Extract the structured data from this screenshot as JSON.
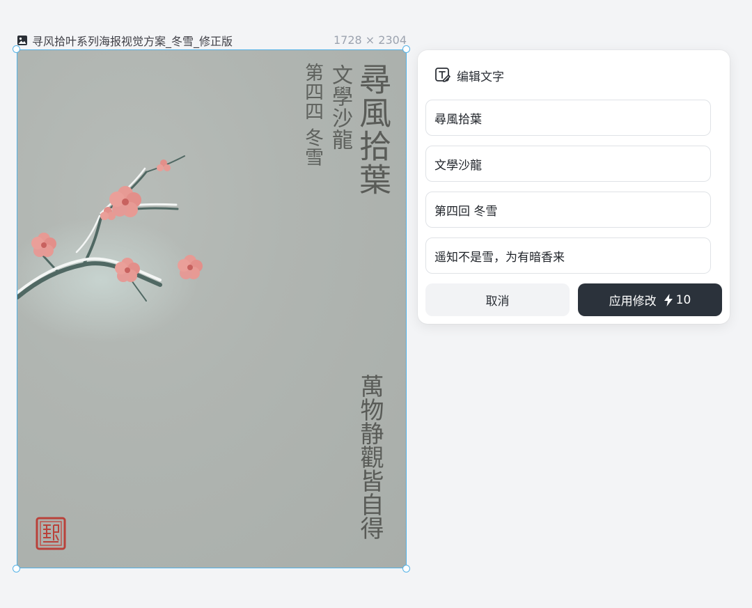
{
  "canvas": {
    "file_name": "寻风拾叶系列海报视觉方案_冬雪_修正版",
    "dimensions": "1728 × 2304",
    "icon": "image-icon"
  },
  "poster": {
    "title": "尋風拾葉",
    "subtitle": "文學沙龍",
    "chapter": "第四四 冬雪",
    "quote": "萬物静觀皆自得",
    "background_color": "#b0b5b1",
    "blossom_color": "#e59a96",
    "seal_color": "#b9413a"
  },
  "edit_panel": {
    "header_icon": "text-edit-icon",
    "header_label": "编辑文字",
    "fields": [
      {
        "value": "尋風拾葉"
      },
      {
        "value": "文學沙龍"
      },
      {
        "value": "第四回 冬雪"
      },
      {
        "value": "遥知不是雪，为有暗香来"
      }
    ],
    "cancel_label": "取消",
    "apply_label": "应用修改",
    "apply_cost": "10",
    "apply_cost_icon": "lightning-icon",
    "apply_color": "#2b323b"
  },
  "selection_color": "#53b2e6"
}
